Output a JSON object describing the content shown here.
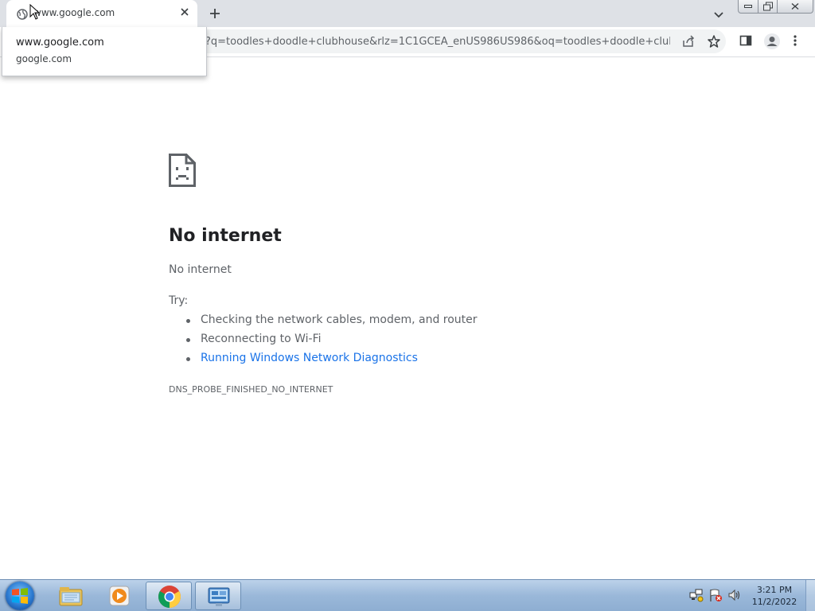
{
  "tab": {
    "title": "www.google.com",
    "favicon": "globe-icon",
    "close_icon": "close-icon"
  },
  "tabstrip": {
    "new_tab_icon": "plus-icon",
    "tab_search_icon": "chevron-down-icon"
  },
  "window_controls": [
    "minimize-icon",
    "maximize-icon",
    "close-icon"
  ],
  "hover_card": {
    "title": "www.google.com",
    "domain": "google.com"
  },
  "toolbar": {
    "url_fragment": "?q=toodles+doodle+clubhouse&rlz=1C1GCEA_enUS986US986&oq=toodles+doodle+clubh...",
    "icons": [
      "share-icon",
      "bookmark-star-icon",
      "side-panel-icon",
      "profile-icon",
      "menu-icon"
    ]
  },
  "error_page": {
    "icon": "sad-page-icon",
    "heading": "No internet",
    "subtitle": "No internet",
    "try_label": "Try:",
    "suggestions": [
      "Checking the network cables, modem, and router",
      "Reconnecting to Wi-Fi",
      "Running Windows Network Diagnostics"
    ],
    "error_code": "DNS_PROBE_FINISHED_NO_INTERNET",
    "link_color": "#1a73e8"
  },
  "taskbar": {
    "apps": [
      "file-explorer-icon",
      "media-player-icon",
      "chrome-icon",
      "control-panel-icon"
    ],
    "active_app": "chrome-icon",
    "tray_icons": [
      "network-icon",
      "action-center-flag-icon",
      "volume-icon"
    ],
    "time": "3:21 PM",
    "date": "11/2/2022"
  }
}
